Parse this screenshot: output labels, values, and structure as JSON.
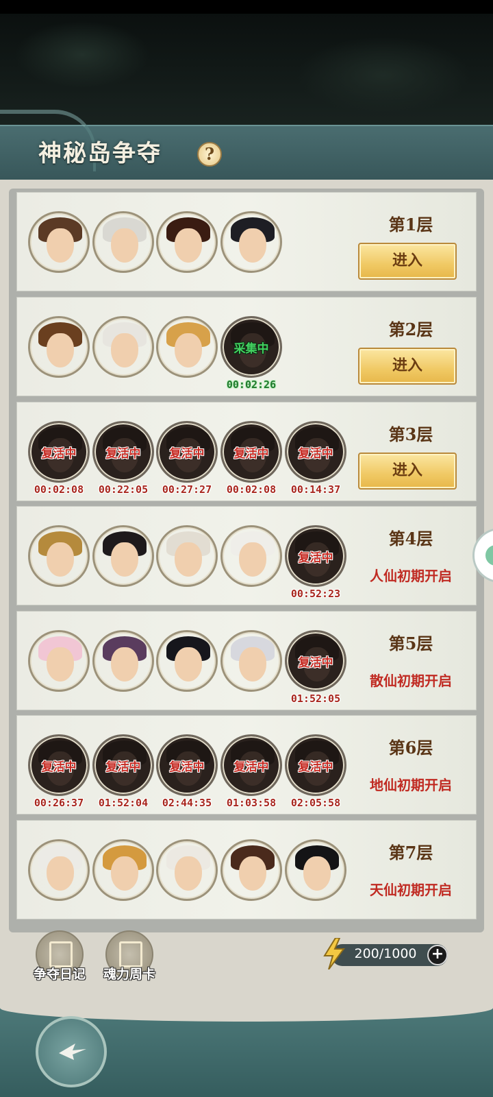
{
  "header": {
    "title": "神秘岛争夺",
    "help_glyph": "?"
  },
  "buttons": {
    "enter": "进入"
  },
  "overlays": {
    "reviving": "复活中",
    "gathering": "采集中"
  },
  "floors": [
    {
      "label": "第1层",
      "button": "进入",
      "status": "",
      "avatars": [
        {
          "state": "normal",
          "hair": "#5b3a25",
          "overlay": "",
          "timer": ""
        },
        {
          "state": "normal",
          "hair": "#d9d8d2",
          "overlay": "",
          "timer": ""
        },
        {
          "state": "normal",
          "hair": "#3a1c12",
          "overlay": "",
          "timer": ""
        },
        {
          "state": "normal",
          "hair": "#1e1e24",
          "overlay": "",
          "timer": ""
        }
      ]
    },
    {
      "label": "第2层",
      "button": "进入",
      "status": "",
      "avatars": [
        {
          "state": "normal",
          "hair": "#6a3f1f",
          "overlay": "",
          "timer": ""
        },
        {
          "state": "normal",
          "hair": "#e7e5df",
          "overlay": "",
          "timer": ""
        },
        {
          "state": "normal",
          "hair": "#d7a14a",
          "overlay": "",
          "timer": ""
        },
        {
          "state": "dark",
          "hair": "#1c1c1c",
          "overlay": "采集中",
          "overlay_color": "green",
          "timer": "00:02:26",
          "timer_color": "green"
        }
      ]
    },
    {
      "label": "第3层",
      "button": "进入",
      "status": "",
      "avatars": [
        {
          "state": "dark",
          "hair": "#2a1a14",
          "overlay": "复活中",
          "overlay_color": "red",
          "timer": "00:02:08",
          "timer_color": "red"
        },
        {
          "state": "dark",
          "hair": "#2a1a14",
          "overlay": "复活中",
          "overlay_color": "red",
          "timer": "00:22:05",
          "timer_color": "red"
        },
        {
          "state": "dark",
          "hair": "#2a1a14",
          "overlay": "复活中",
          "overlay_color": "red",
          "timer": "00:27:27",
          "timer_color": "red"
        },
        {
          "state": "dark",
          "hair": "#2a1a14",
          "overlay": "复活中",
          "overlay_color": "red",
          "timer": "00:02:08",
          "timer_color": "red"
        },
        {
          "state": "dark",
          "hair": "#2a1a14",
          "overlay": "复活中",
          "overlay_color": "red",
          "timer": "00:14:37",
          "timer_color": "red"
        }
      ]
    },
    {
      "label": "第4层",
      "button": "",
      "status": "人仙初期开启",
      "avatars": [
        {
          "state": "normal",
          "hair": "#b58a3c",
          "overlay": "",
          "timer": ""
        },
        {
          "state": "normal",
          "hair": "#1e1a1c",
          "overlay": "",
          "timer": ""
        },
        {
          "state": "normal",
          "hair": "#e2ddd2",
          "overlay": "",
          "timer": ""
        },
        {
          "state": "normal",
          "hair": "#efeee9",
          "overlay": "",
          "timer": ""
        },
        {
          "state": "dark",
          "hair": "#2a1a14",
          "overlay": "复活中",
          "overlay_color": "red",
          "timer": "00:52:23",
          "timer_color": "red"
        }
      ]
    },
    {
      "label": "第5层",
      "button": "",
      "status": "散仙初期开启",
      "avatars": [
        {
          "state": "normal",
          "hair": "#f1c6d4",
          "overlay": "",
          "timer": ""
        },
        {
          "state": "normal",
          "hair": "#5a3c5e",
          "overlay": "",
          "timer": ""
        },
        {
          "state": "normal",
          "hair": "#16161c",
          "overlay": "",
          "timer": ""
        },
        {
          "state": "normal",
          "hair": "#d7d8de",
          "overlay": "",
          "timer": ""
        },
        {
          "state": "dark",
          "hair": "#2a1a14",
          "overlay": "复活中",
          "overlay_color": "red",
          "timer": "01:52:05",
          "timer_color": "red"
        }
      ]
    },
    {
      "label": "第6层",
      "button": "",
      "status": "地仙初期开启",
      "avatars": [
        {
          "state": "dark",
          "hair": "#2a1a14",
          "overlay": "复活中",
          "overlay_color": "red",
          "timer": "00:26:37",
          "timer_color": "red"
        },
        {
          "state": "dark",
          "hair": "#2a1a14",
          "overlay": "复活中",
          "overlay_color": "red",
          "timer": "01:52:04",
          "timer_color": "red"
        },
        {
          "state": "dark",
          "hair": "#2a1a14",
          "overlay": "复活中",
          "overlay_color": "red",
          "timer": "02:44:35",
          "timer_color": "red"
        },
        {
          "state": "dark",
          "hair": "#2a1a14",
          "overlay": "复活中",
          "overlay_color": "red",
          "timer": "01:03:58",
          "timer_color": "red"
        },
        {
          "state": "dark",
          "hair": "#2a1a14",
          "overlay": "复活中",
          "overlay_color": "red",
          "timer": "02:05:58",
          "timer_color": "red"
        }
      ]
    },
    {
      "label": "第7层",
      "button": "",
      "status": "天仙初期开启",
      "avatars": [
        {
          "state": "normal",
          "hair": "#ecebe6",
          "overlay": "",
          "timer": ""
        },
        {
          "state": "normal",
          "hair": "#d49a3f",
          "overlay": "",
          "timer": ""
        },
        {
          "state": "normal",
          "hair": "#ece9e2",
          "overlay": "",
          "timer": ""
        },
        {
          "state": "normal",
          "hair": "#4a2a1c",
          "overlay": "",
          "timer": ""
        },
        {
          "state": "normal",
          "hair": "#141416",
          "overlay": "",
          "timer": ""
        }
      ]
    }
  ],
  "bottom": {
    "diary_label": "争夺日记",
    "weekly_card_label": "魂力周卡",
    "energy": "200/1000",
    "plus_glyph": "+"
  },
  "icons": {
    "help": "question-icon",
    "diary": "diary-icon",
    "weekly_card": "card-icon",
    "energy": "lightning-icon",
    "back": "back-arrow-icon",
    "side": "chat-icon"
  },
  "colors": {
    "header_teal": "#4a6d70",
    "button_gold": "#f0c964",
    "status_red": "#c02a22",
    "floor_brown": "#5a3516",
    "timer_red": "#a8261d",
    "timer_green": "#1f7a2c"
  }
}
